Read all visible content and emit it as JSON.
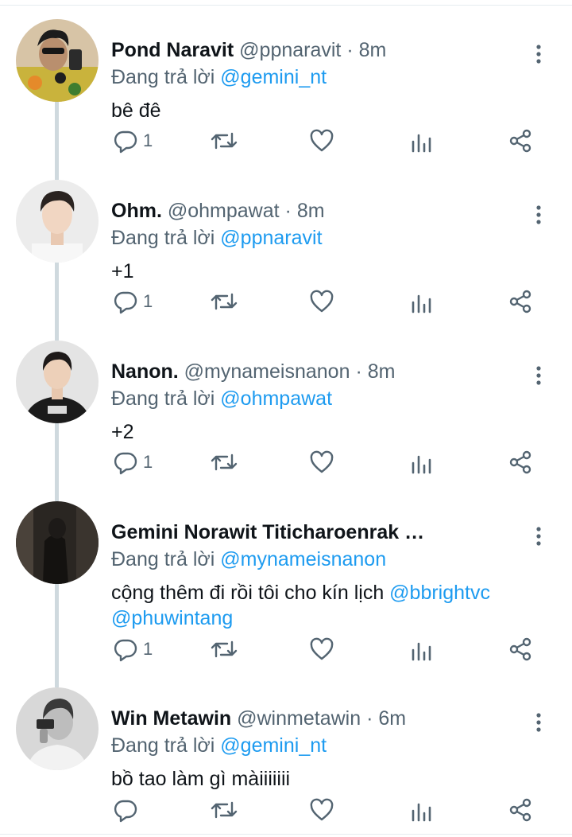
{
  "labels": {
    "replying_prefix": "Đang trả lời"
  },
  "colors": {
    "text": "#0f1419",
    "secondary": "#536471",
    "link": "#1d9bf0",
    "thread_line": "#cfd9de",
    "divider": "#e6ecf0"
  },
  "icons": [
    "reply-icon",
    "retweet-icon",
    "like-icon",
    "analytics-icon",
    "share-icon",
    "more-vertical-icon"
  ],
  "tweets": [
    {
      "name": "Pond Naravit",
      "handle": "@ppnaravit",
      "dot": "·",
      "time": "8m",
      "replying_to": "@gemini_nt",
      "text": "bê đê",
      "reply_count": "1"
    },
    {
      "name": "Ohm.",
      "handle": "@ohmpawat",
      "dot": "·",
      "time": "8m",
      "replying_to": "@ppnaravit",
      "text": "+1",
      "reply_count": "1"
    },
    {
      "name": "Nanon.",
      "handle": "@mynameisnanon",
      "dot": "·",
      "time": "8m",
      "replying_to": "@ohmpawat",
      "text": "+2",
      "reply_count": "1"
    },
    {
      "name": "Gemini Norawit Titicharoenrak …",
      "handle": "",
      "dot": "",
      "time": "",
      "replying_to": "@mynameisnanon",
      "text_plain": "cộng thêm đi rồi tôi cho kín lịch ",
      "text_mention_1": "@bbrightvc",
      "text_mention_2": "@phuwintang",
      "reply_count": "1"
    },
    {
      "name": "Win Metawin",
      "handle": "@winmetawin",
      "dot": "·",
      "time": "6m",
      "replying_to": "@gemini_nt",
      "text": "bồ tao làm gì màiiiiiii",
      "reply_count": ""
    }
  ]
}
